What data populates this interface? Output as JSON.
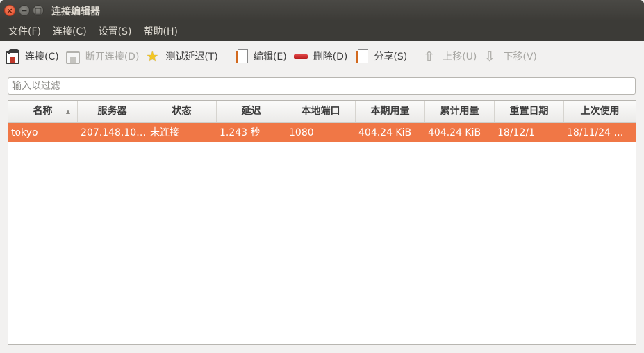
{
  "window": {
    "title": "连接编辑器",
    "close": "×",
    "minimize": "−",
    "maximize": "□"
  },
  "menu": [
    "文件(F)",
    "连接(C)",
    "设置(S)",
    "帮助(H)"
  ],
  "toolbar": {
    "connect": "连接(C)",
    "disconnect": "断开连接(D)",
    "test_latency": "测试延迟(T)",
    "edit": "编辑(E)",
    "delete": "删除(D)",
    "share": "分享(S)",
    "move_up": "上移(U)",
    "move_down": "下移(V)"
  },
  "filter": {
    "placeholder": "输入以过滤",
    "value": ""
  },
  "table": {
    "columns": [
      "名称",
      "服务器",
      "状态",
      "延迟",
      "本地端口",
      "本期用量",
      "累计用量",
      "重置日期",
      "上次使用"
    ],
    "sort_indicator": "▲",
    "rows": [
      {
        "name": "tokyo",
        "server": "207.148.10…",
        "status": "未连接",
        "latency": "1.243 秒",
        "local_port": "1080",
        "period_usage": "404.24 KiB",
        "total_usage": "404.24 KiB",
        "reset_date": "18/12/1",
        "last_used": "18/11/24 …"
      }
    ]
  },
  "colors": {
    "selection": "#f07746",
    "titlebar": "#3c3b37",
    "close_button": "#e0492a"
  }
}
